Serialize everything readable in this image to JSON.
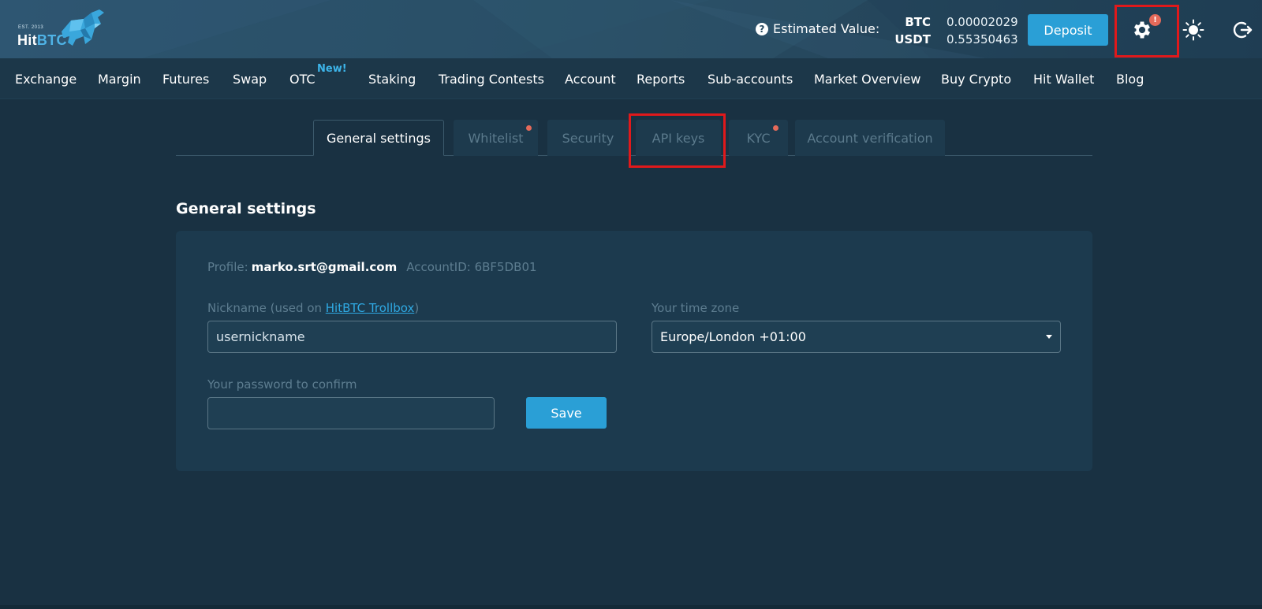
{
  "header": {
    "logo": {
      "est": "EST. 2013",
      "brand_hit": "Hit",
      "brand_btc": "BTC"
    },
    "estimated_value_label": "Estimated Value:",
    "help_icon_glyph": "?",
    "balances": [
      {
        "currency": "BTC",
        "value": "0.00002029"
      },
      {
        "currency": "USDT",
        "value": "0.55350463"
      }
    ],
    "deposit_label": "Deposit",
    "notification_badge": "!",
    "icons": [
      "settings-gear-icon",
      "sun-theme-icon",
      "logout-icon"
    ]
  },
  "nav": {
    "items": [
      "Exchange",
      "Margin",
      "Futures",
      "Swap",
      "OTC",
      "Staking",
      "Trading Contests",
      "Account",
      "Reports",
      "Sub-accounts",
      "Market Overview",
      "Buy Crypto",
      "Hit Wallet",
      "Blog"
    ],
    "otc_badge": "New!"
  },
  "tabs": [
    {
      "label": "General settings",
      "active": true
    },
    {
      "label": "Whitelist",
      "dot": true
    },
    {
      "label": "Security"
    },
    {
      "label": "API keys"
    },
    {
      "label": "KYC",
      "dot": true
    },
    {
      "label": "Account verification"
    }
  ],
  "general": {
    "title": "General settings",
    "profile_label": "Profile:",
    "email": "marko.srt@gmail.com",
    "account_id": "AccountID: 6BF5DB01",
    "nickname_label_prefix": "Nickname (used on ",
    "nickname_link": "HitBTC Trollbox",
    "nickname_label_suffix": ")",
    "nickname_value": "usernickname",
    "timezone_label": "Your time zone",
    "timezone_value": "Europe/London +01:00",
    "password_label": "Your password to confirm",
    "password_value": "",
    "save_label": "Save"
  },
  "colors": {
    "accent": "#2a9fd6",
    "background": "#193142",
    "panel": "#1c3a4e",
    "highlight": "#e0191b",
    "notification": "#e46a5a"
  }
}
